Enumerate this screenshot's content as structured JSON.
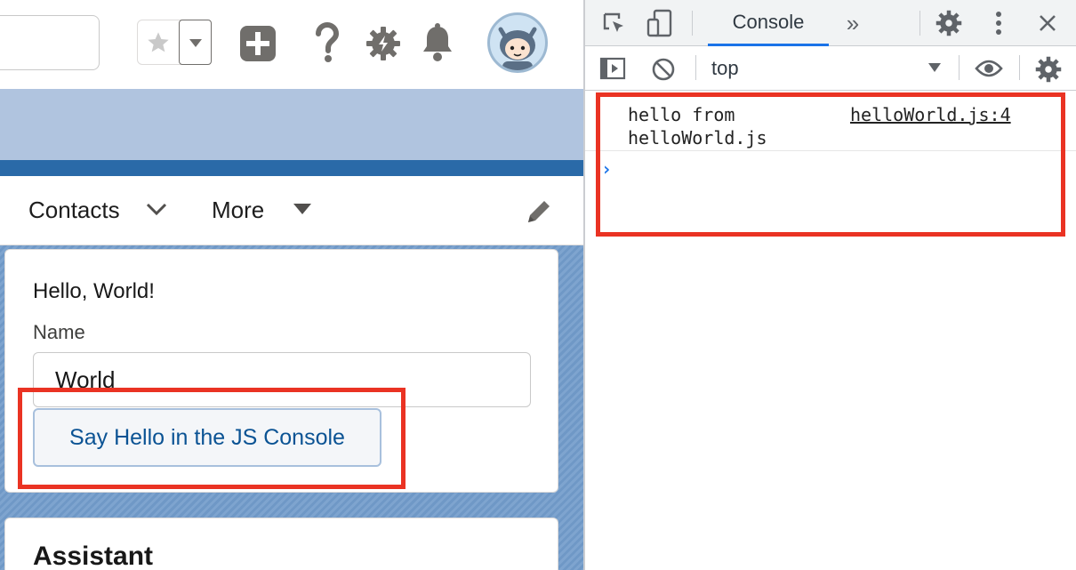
{
  "app": {
    "nav": {
      "items": [
        {
          "label": "Contacts"
        },
        {
          "label": "More"
        }
      ]
    },
    "hello_card": {
      "greeting": "Hello, World!",
      "name_label": "Name",
      "name_value": "World",
      "button_label": "Say Hello in the JS Console"
    },
    "assistant_card": {
      "title": "Assistant"
    },
    "icons": [
      "star-icon",
      "chevron-down-icon",
      "add-icon",
      "help-icon",
      "setup-gear-icon",
      "notifications-bell-icon",
      "avatar",
      "chevron-down-icon",
      "dropdown-triangle-icon",
      "edit-pencil-icon"
    ]
  },
  "devtools": {
    "toolbar": {
      "active_tab": "Console",
      "more_tabs": "»",
      "icons": [
        "inspect-element-icon",
        "device-toolbar-icon",
        "more-tabs-icon",
        "settings-gear-icon",
        "kebab-menu-icon",
        "close-icon"
      ]
    },
    "console_bar": {
      "context": "top",
      "icons": [
        "sidebar-toggle-icon",
        "clear-console-icon",
        "dropdown-caret-icon",
        "live-expression-eye-icon",
        "console-settings-gear-icon"
      ]
    },
    "log": {
      "message": "hello from\nhelloWorld.js",
      "source": "helloWorld.js:4"
    },
    "prompt": "›"
  },
  "colors": {
    "annotation_red": "#ea3323",
    "brand_blue": "#2a6aa8",
    "band_blue": "#b0c4df",
    "devtools_accent": "#1a73e8",
    "button_text": "#0b5394"
  }
}
